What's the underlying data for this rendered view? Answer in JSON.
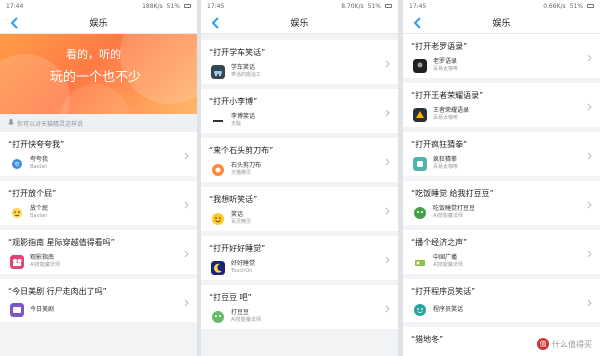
{
  "screens": [
    {
      "status": {
        "time": "17:44",
        "speed": "188K/s",
        "battery": "51%"
      },
      "nav_title": "娱乐",
      "banner": {
        "line1": "看的，听的",
        "line2": "玩的一个也不少"
      },
      "hint": "你可以对天猫精灵这样说",
      "cards": [
        {
          "query": "“打开快夸夸我”",
          "name": "夸夸我",
          "sub": "Baolan"
        },
        {
          "query": "“打开放个屁”",
          "name": "放个屁",
          "sub": "Baolan"
        },
        {
          "query": "“观影指南 星际穿越值得看吗”",
          "name": "观影指南",
          "sub": "AI技能魔法师"
        },
        {
          "query": "“今日美剧 行尸走肉出了吗”",
          "name": "今日美剧",
          "sub": ""
        }
      ]
    },
    {
      "status": {
        "time": "17:45",
        "speed": "8.70K/s",
        "battery": "51%"
      },
      "nav_title": "娱乐",
      "cards": [
        {
          "query": "“打开学车笑话”",
          "name": "学车笑话",
          "sub": "笑话的搬运工"
        },
        {
          "query": "“打开小李博”",
          "name": "李博笑话",
          "sub": "无敌"
        },
        {
          "query": "“来个石头剪刀布”",
          "name": "石头剪刀布",
          "sub": "天猫精灵"
        },
        {
          "query": "“我想听笑话”",
          "name": "笑话",
          "sub": "百灵精灵"
        },
        {
          "query": "“打开好好睡觉”",
          "name": "好好睡觉",
          "sub": "TouchOn"
        },
        {
          "query": "“打豆豆 吧”",
          "name": "打豆豆",
          "sub": "AI技能魔法师"
        }
      ]
    },
    {
      "status": {
        "time": "17:45",
        "speed": "0.66K/s",
        "battery": "51%"
      },
      "nav_title": "娱乐",
      "cards": [
        {
          "query": "“打开老罗语录”",
          "name": "老罗语录",
          "sub": "百易太咖啡"
        },
        {
          "query": "“打开王者荣耀语录”",
          "name": "王者荣耀语录",
          "sub": "百易太咖啡"
        },
        {
          "query": "“打开疯狂猜拳”",
          "name": "疯狂猜拳",
          "sub": "百易太咖啡"
        },
        {
          "query": "“吃饭睡觉 给我打豆豆”",
          "name": "吃饭睡觉打豆豆",
          "sub": "AI技能魔法师"
        },
        {
          "query": "“播个经济之声”",
          "name": "中国广播",
          "sub": "AI技能魔法师"
        },
        {
          "query": "“打开程序员笑话”",
          "name": "程序员笑话",
          "sub": ""
        },
        {
          "query": "“猎地冬”",
          "name": "",
          "sub": ""
        }
      ],
      "watermark": "什么值得买"
    }
  ],
  "colors": {
    "accent": "#2f9bf0",
    "banner": "#ff8a45"
  }
}
